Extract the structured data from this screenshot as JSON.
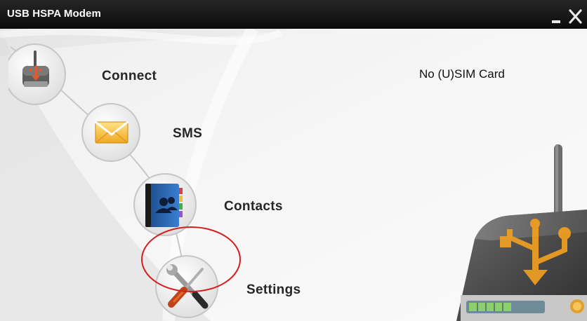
{
  "window": {
    "title": "USB HSPA Modem",
    "minimize_icon": "minimize-icon",
    "close_icon": "close-icon"
  },
  "status": {
    "sim_text": "No (U)SIM Card"
  },
  "menu": {
    "items": [
      {
        "label": "Connect",
        "icon": "modem-connect-icon"
      },
      {
        "label": "SMS",
        "icon": "envelope-icon"
      },
      {
        "label": "Contacts",
        "icon": "address-book-icon"
      },
      {
        "label": "Settings",
        "icon": "tools-icon"
      }
    ]
  },
  "colors": {
    "titlebar": "#111111",
    "background": "#e9e9e9",
    "label_text": "#262626",
    "highlight_ring": "#d41f1f",
    "usb_arrow": "#f0a020"
  }
}
